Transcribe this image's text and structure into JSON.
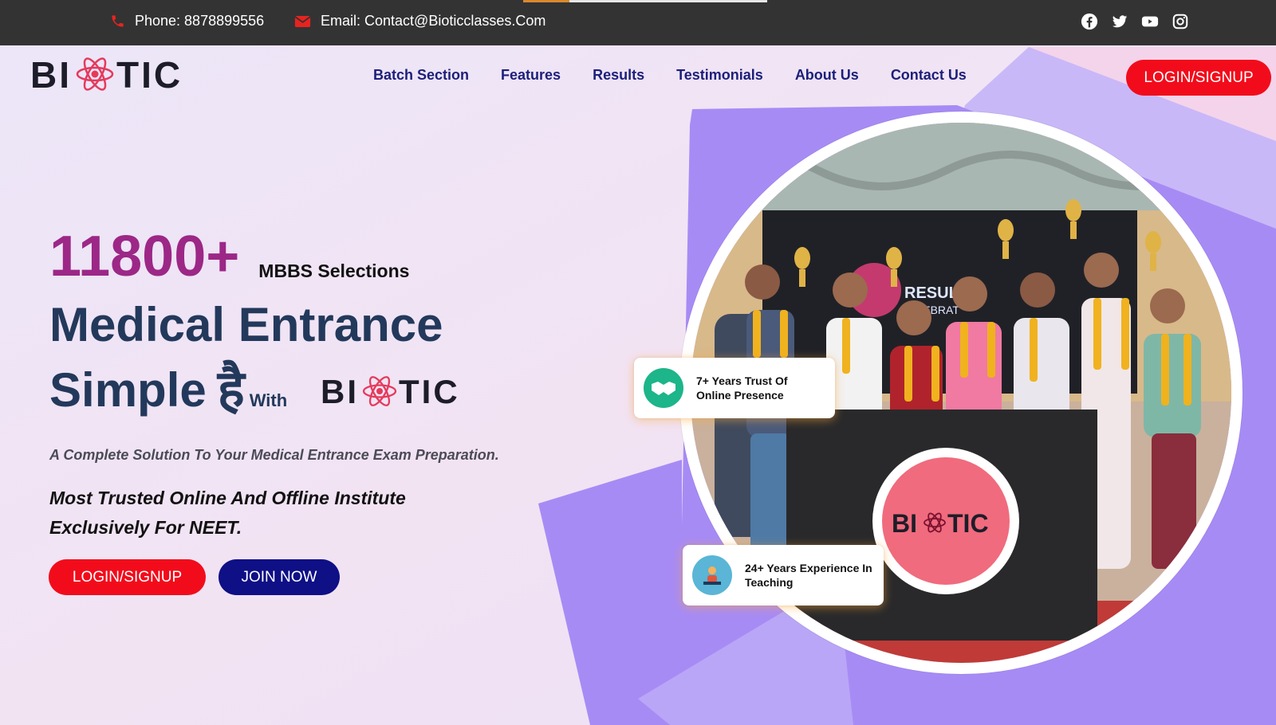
{
  "topbar": {
    "phone": "Phone: 8878899556",
    "email": "Email: Contact@Bioticclasses.Com",
    "page_progress": 0.19,
    "social_icons": [
      "facebook-icon",
      "twitter-icon",
      "youtube-icon",
      "instagram-icon"
    ]
  },
  "brand": {
    "logo_text_left": "BI",
    "logo_text_right": "TIC"
  },
  "nav": {
    "items": [
      "Batch Section",
      "Features",
      "Results",
      "Testimonials",
      "About Us",
      "Contact Us"
    ],
    "login_label": "LOGIN/SIGNUP"
  },
  "hero": {
    "stat_number": "11800+",
    "stat_label": "MBBS Selections",
    "headline_line1": "Medical Entrance",
    "headline_simple": "Simple",
    "headline_hai": "है",
    "headline_with": "With",
    "subtitle": "A Complete Solution To Your Medical Entrance Exam Preparation.",
    "tagline": "Most Trusted Online And Offline Institute Exclusively For NEET.",
    "login_label": "LOGIN/SIGNUP",
    "join_label": "JOIN NOW"
  },
  "photo": {
    "screen_text_1": "RESULT",
    "screen_text_2": "CELEBRAT"
  },
  "badges": {
    "trust": "7+ Years Trust Of Online Presence",
    "experience": "24+ Years Experience In Teaching"
  },
  "colors": {
    "accent_red": "#f20c1b",
    "navy": "#0f0f86",
    "purple_shape": "#a78bf5",
    "stat_magenta": "#9c2787",
    "headline_navy": "#23395b"
  }
}
